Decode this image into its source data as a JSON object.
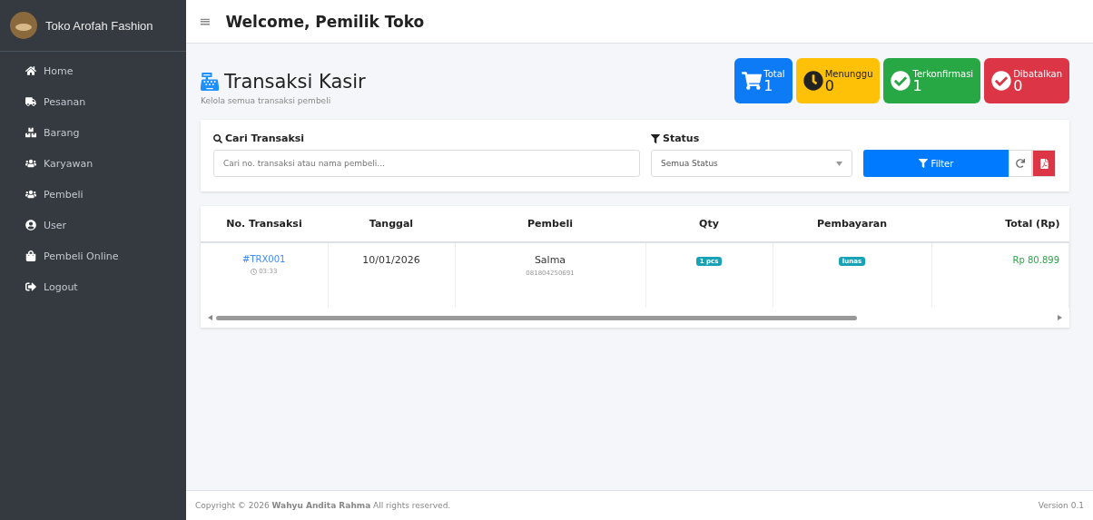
{
  "brand": {
    "name": "Toko Arofah Fashion"
  },
  "sidebar": {
    "items": [
      {
        "label": "Home",
        "kind": "home",
        "selected": false
      },
      {
        "label": "Pesanan",
        "kind": "truck",
        "selected": false
      },
      {
        "label": "Barang",
        "kind": "boxes",
        "selected": false
      },
      {
        "label": "Karyawan",
        "kind": "users",
        "selected": false
      },
      {
        "label": "Pembeli",
        "kind": "users",
        "selected": false
      },
      {
        "label": "User",
        "kind": "user",
        "selected": false
      },
      {
        "label": "Pembeli Online",
        "kind": "bag",
        "selected": false
      },
      {
        "label": "Logout",
        "kind": "logout",
        "selected": false
      }
    ]
  },
  "header": {
    "menu_icon": "≡",
    "title": "Welcome, Pemilik Toko"
  },
  "page": {
    "title": "Transaksi Kasir",
    "subtitle": "Kelola semua transaksi pembeli"
  },
  "stats": [
    {
      "label": "Total",
      "value": "1",
      "kind": "cart",
      "color": "#0d7bf5"
    },
    {
      "label": "Menunggu",
      "value": "0",
      "kind": "clock",
      "color": "#ffc107"
    },
    {
      "label": "Terkonfirmasi",
      "value": "1",
      "kind": "check",
      "color": "#28a745"
    },
    {
      "label": "Dibatalkan",
      "value": "0",
      "kind": "check",
      "color": "#dc3545"
    }
  ],
  "filters": {
    "search_label": "Cari Transaksi",
    "search_placeholder": "Cari no. transaksi atau nama pembeli...",
    "status_label": "Status",
    "status_value": "Semua Status",
    "filter_button": "Filter"
  },
  "table": {
    "columns": [
      "No. Transaksi",
      "Tanggal",
      "Pembeli",
      "Qty",
      "Pembayaran",
      "Total (Rp)"
    ],
    "rows": [
      {
        "id": "#TRX001",
        "time": "03:33",
        "date": "10/01/2026",
        "buyer": "Salma",
        "phone": "081804250691",
        "qty": "1 pcs",
        "payment": "lunas",
        "total": "Rp 80.899"
      }
    ]
  },
  "footer": {
    "copyright": "Copyright © 2026 **Wahyu Andita Rahma** All rights reserved.",
    "version": "Version 0.1"
  }
}
